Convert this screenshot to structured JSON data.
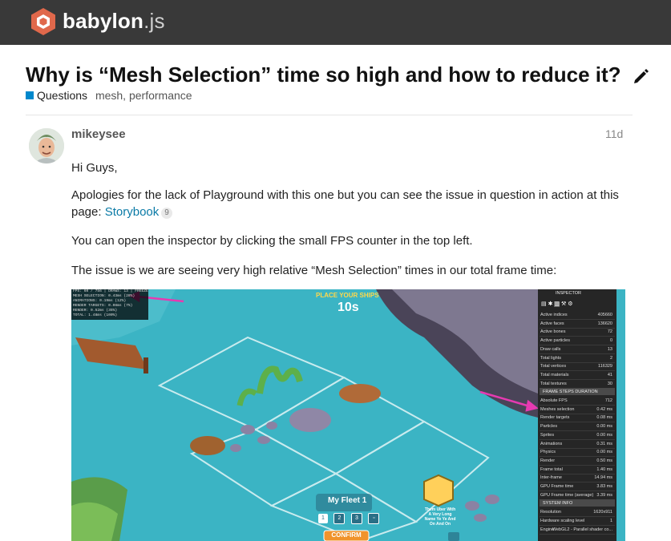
{
  "header": {
    "logo_name": "babylon",
    "logo_ext": ".js",
    "brand_color": "#e0684b"
  },
  "topic": {
    "title": "Why is “Mesh Selection” time so high and how to reduce it?",
    "category": "Questions",
    "category_color": "#0088cc",
    "tags": [
      "mesh,",
      "performance"
    ]
  },
  "post": {
    "username": "mikeysee",
    "time": "11d",
    "greeting": "Hi Guys,",
    "para2_text": "Apologies for the lack of Playground with this one but you can see the issue in question in action at this page: ",
    "para2_link": "Storybook",
    "para2_link_count": "9",
    "para3": "You can open the inspector by clicking the small FPS counter in the top left.",
    "para4": "The issue is we are seeing very high relative “Mesh Selection” times in our total frame time:"
  },
  "screenshot": {
    "fps_lines": [
      "FPS: 60 / 756 | DRAWS: 13 | FREEZE",
      "MESH SELECTION: 0.43ms (28%)",
      "ANIMATIONS: 0.19ms (12%)",
      "RENDER TARGETS: 0.08ms (7%)",
      "RENDER: 0.52ms (35%)",
      "TOTAL: 1.48ms (100%)"
    ],
    "game_banner": "PLACE YOUR SHIPS",
    "timer": "10s",
    "fleet_label": "My Fleet 1",
    "fleet_buttons": [
      "1",
      "2",
      "3"
    ],
    "confirm_label": "CONFIRM",
    "speech_text": "Them Uber With A Very Long Name Ye Ye And On And On",
    "inspector_title": "INSPECTOR",
    "stats": [
      {
        "label": "Active indices",
        "value": "405660"
      },
      {
        "label": "Active faces",
        "value": "136620"
      },
      {
        "label": "Active bones",
        "value": "72"
      },
      {
        "label": "Active particles",
        "value": "0"
      },
      {
        "label": "Draw calls",
        "value": "13"
      },
      {
        "label": "Total lights",
        "value": "2"
      },
      {
        "label": "Total vertices",
        "value": "116329"
      },
      {
        "label": "Total materials",
        "value": "41"
      },
      {
        "label": "Total textures",
        "value": "30"
      }
    ],
    "section_duration": "FRAME STEPS DURATION",
    "durations": [
      {
        "label": "Absolute FPS",
        "value": "712"
      },
      {
        "label": "Meshes selection",
        "value": "0.42 ms"
      },
      {
        "label": "Render targets",
        "value": "0.08 ms"
      },
      {
        "label": "Particles",
        "value": "0.00 ms"
      },
      {
        "label": "Sprites",
        "value": "0.00 ms"
      },
      {
        "label": "Animations",
        "value": "0.31 ms"
      },
      {
        "label": "Physics",
        "value": "0.00 ms"
      },
      {
        "label": "Render",
        "value": "0.50 ms"
      },
      {
        "label": "Frame total",
        "value": "1.40 ms"
      },
      {
        "label": "Inter-frame",
        "value": "14.94 ms"
      },
      {
        "label": "GPU Frame time",
        "value": "3.83 ms"
      },
      {
        "label": "GPU Frame time (average)",
        "value": "3.39 ms"
      }
    ],
    "section_system": "SYSTEM INFO",
    "system": [
      {
        "label": "Resolution",
        "value": "1620x911"
      },
      {
        "label": "Hardware scaling level",
        "value": "1"
      },
      {
        "label": "Engine",
        "value": "WebGL2 - Parallel shader co..."
      }
    ]
  }
}
